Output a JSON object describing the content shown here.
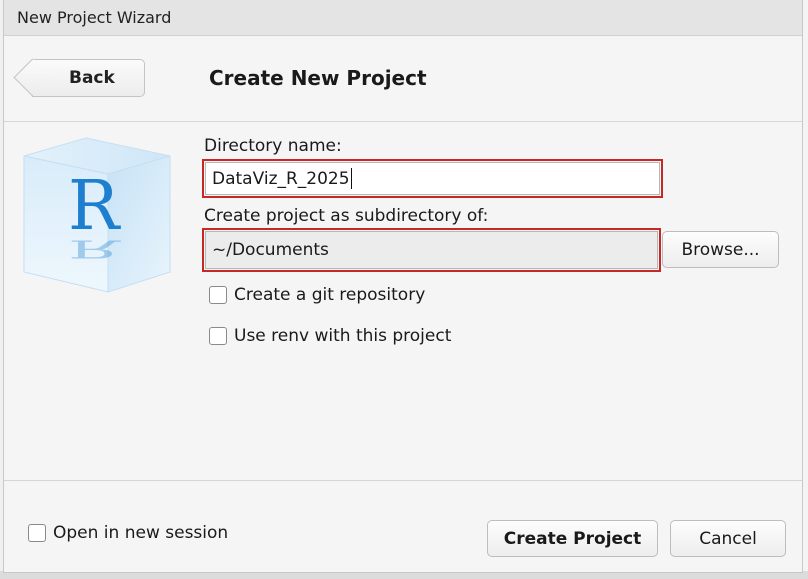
{
  "window": {
    "title": "New Project Wizard"
  },
  "header": {
    "back_label": "Back",
    "title": "Create New Project"
  },
  "form": {
    "directory_label": "Directory name:",
    "directory_value": "DataViz_R_2025",
    "parent_label": "Create project as subdirectory of:",
    "parent_value": "~/Documents",
    "browse_label": "Browse...",
    "git_label": "Create a git repository",
    "git_checked": false,
    "renv_label": "Use renv with this project",
    "renv_checked": false
  },
  "footer": {
    "new_session_label": "Open in new session",
    "new_session_checked": false,
    "create_label": "Create Project",
    "cancel_label": "Cancel"
  },
  "icons": {
    "logo": "r-logo-icon"
  },
  "colors": {
    "highlight": "#c62828",
    "logo_blue": "#1e7fd0"
  }
}
